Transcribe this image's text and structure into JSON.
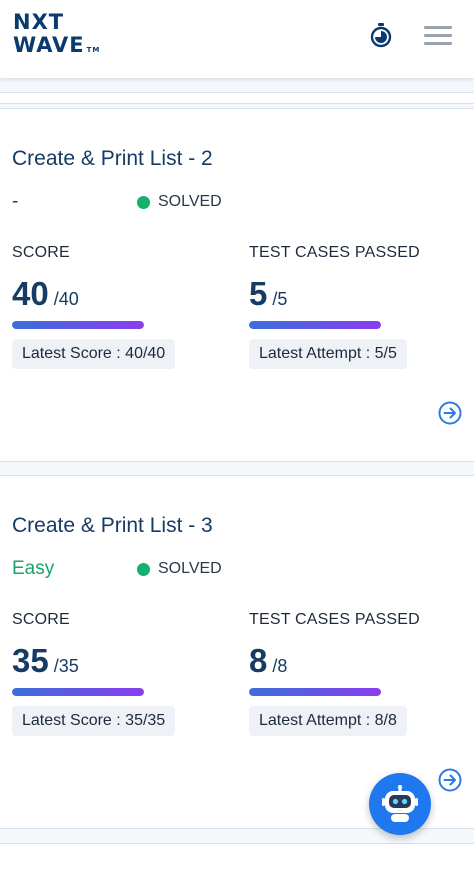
{
  "header": {
    "logo_line1": "NXT",
    "logo_line2": "WAVE",
    "logo_tm": "TM",
    "timer_icon": "stopwatch-icon",
    "menu_icon": "hamburger-menu-icon"
  },
  "cards": [
    {
      "title": "Create & Print List - 2",
      "difficulty": "-",
      "status": "SOLVED",
      "score_label": "SCORE",
      "score_value": "40",
      "score_total": "/40",
      "score_progress": 1.0,
      "latest_score": "Latest Score : 40/40",
      "tests_label": "TEST CASES PASSED",
      "tests_value": "5",
      "tests_total": "/5",
      "tests_progress": 1.0,
      "latest_attempt": "Latest Attempt : 5/5",
      "arrow_icon": "arrow-right-circle-icon"
    },
    {
      "title": "Create & Print List - 3",
      "difficulty": "Easy",
      "status": "SOLVED",
      "score_label": "SCORE",
      "score_value": "35",
      "score_total": "/35",
      "score_progress": 1.0,
      "latest_score": "Latest Score : 35/35",
      "tests_label": "TEST CASES PASSED",
      "tests_value": "8",
      "tests_total": "/8",
      "tests_progress": 1.0,
      "latest_attempt": "Latest Attempt : 8/8",
      "arrow_icon": "arrow-right-circle-icon"
    }
  ],
  "assistant_fab": {
    "icon": "robot-icon"
  },
  "colors": {
    "brand": "#0b3a6e",
    "title": "#183b63",
    "solved": "#14b06c",
    "easy": "#1aa36a",
    "progress_start": "#3b6fd8",
    "progress_end": "#8a3df0",
    "fab": "#1f78f0"
  }
}
